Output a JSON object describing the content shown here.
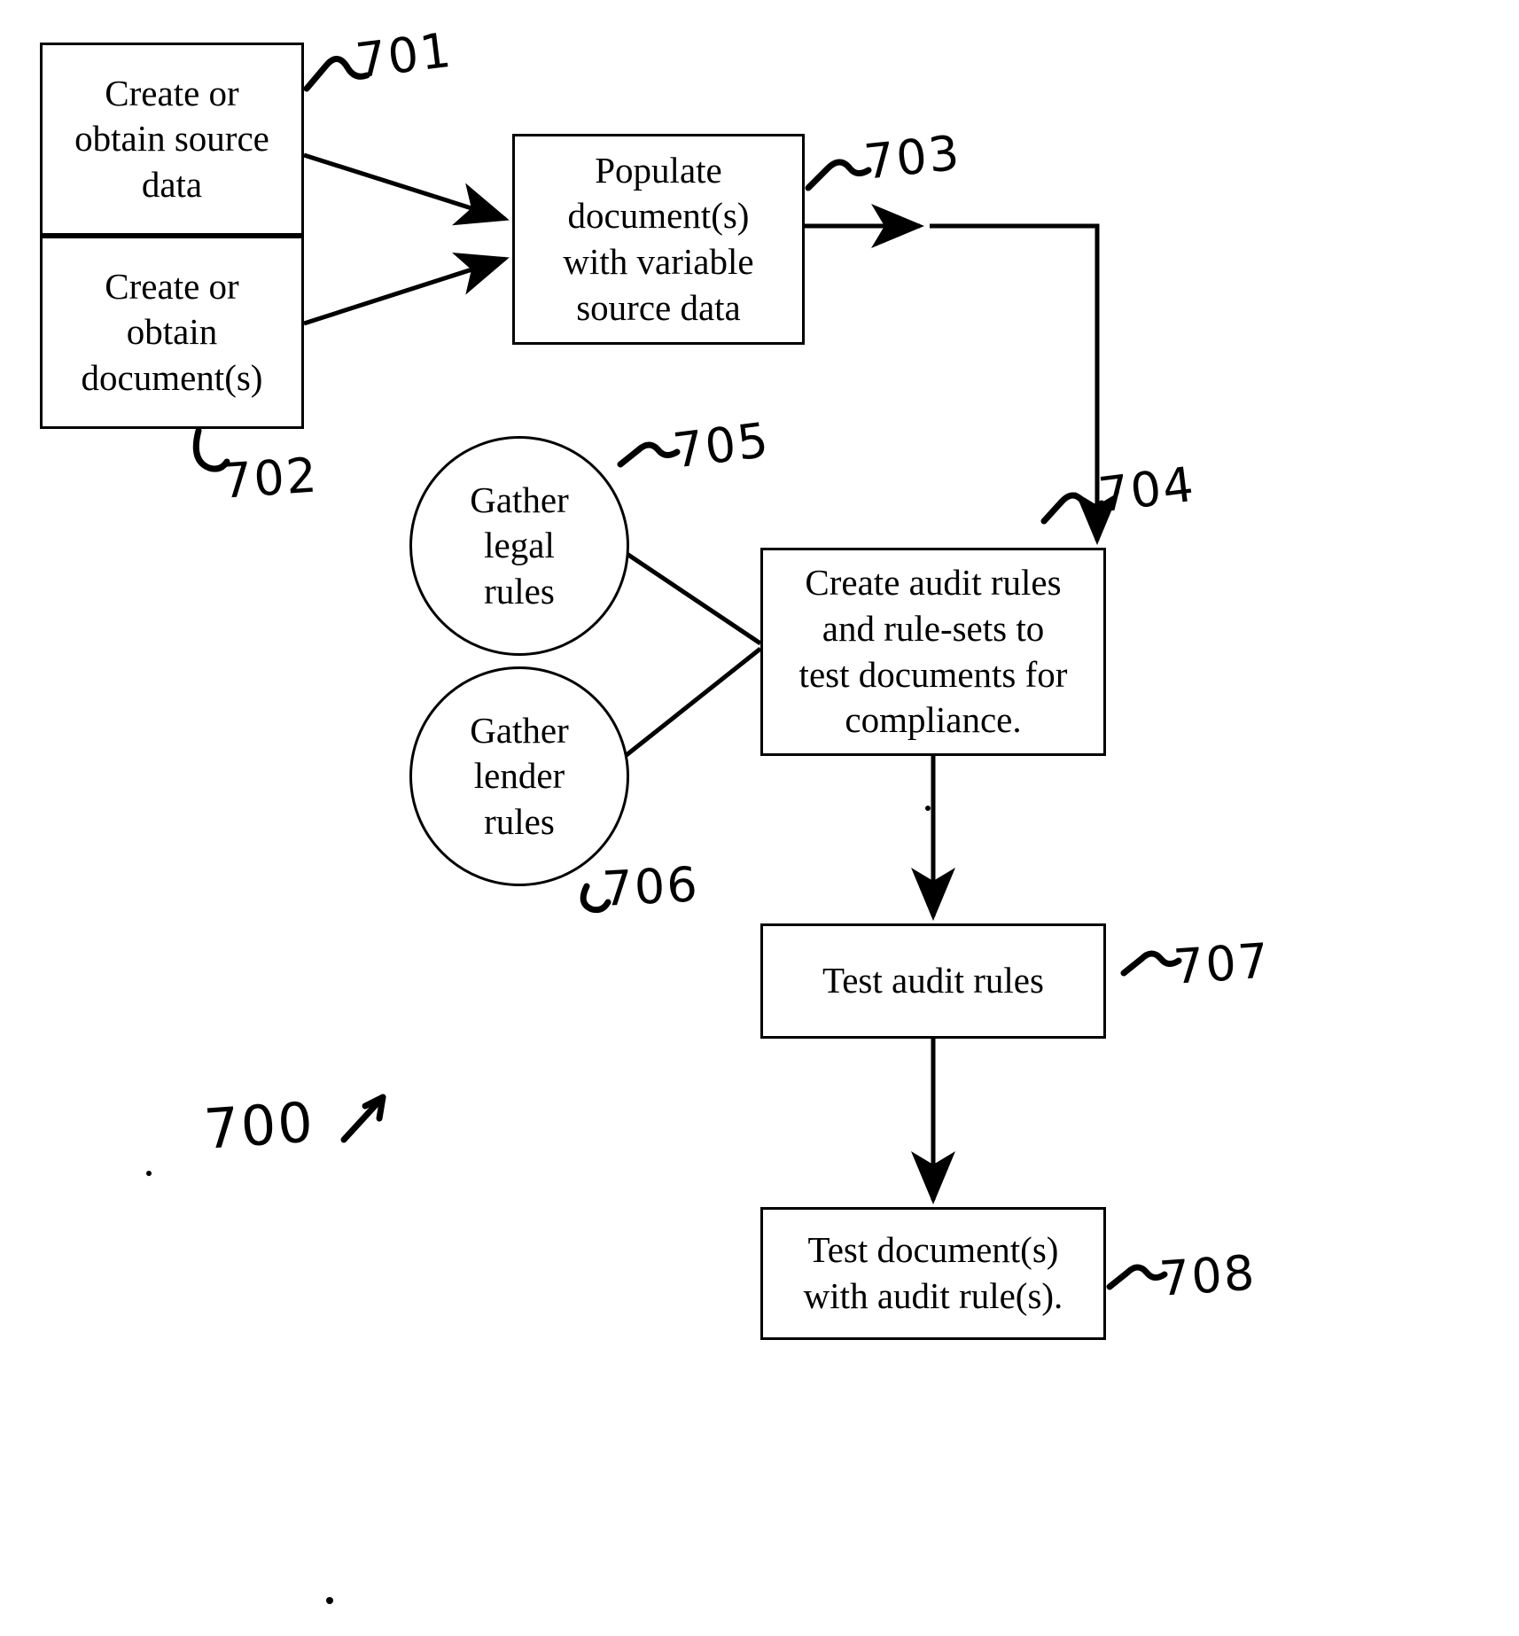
{
  "figure": {
    "type": "patent-flowchart",
    "overall_ref": "700",
    "overall_ref_arrow": "↗"
  },
  "nodes": [
    {
      "id": "701",
      "shape": "rectangle",
      "label": "Create or\nobtain source\ndata",
      "ref": "701",
      "ref_lead": "∼"
    },
    {
      "id": "702",
      "shape": "rectangle",
      "label": "Create or\nobtain\ndocument(s)",
      "ref": "702",
      "ref_lead": "⸂"
    },
    {
      "id": "703",
      "shape": "rectangle",
      "label": "Populate\ndocument(s)\nwith variable\nsource data",
      "ref": "703",
      "ref_lead": "∼"
    },
    {
      "id": "704",
      "shape": "rectangle",
      "label": "Create audit rules\nand rule-sets to\ntest documents for\ncompliance.",
      "ref": "704",
      "ref_lead": "∼"
    },
    {
      "id": "705",
      "shape": "circle",
      "label": "Gather\nlegal\nrules",
      "ref": "705",
      "ref_lead": "∼"
    },
    {
      "id": "706",
      "shape": "circle",
      "label": "Gather\nlender\nrules",
      "ref": "706",
      "ref_lead": "⸂"
    },
    {
      "id": "707",
      "shape": "rectangle",
      "label": "Test audit rules",
      "ref": "707",
      "ref_lead": "∼"
    },
    {
      "id": "708",
      "shape": "rectangle",
      "label": "Test document(s)\nwith audit rule(s).",
      "ref": "708",
      "ref_lead": "∼"
    }
  ],
  "refs": {
    "r700": "700",
    "r701": "701",
    "r702": "702",
    "r703": "703",
    "r704": "704",
    "r705": "705",
    "r706": "706",
    "r707": "707",
    "r708": "708"
  },
  "connectors": [
    {
      "from": "701",
      "to": "703",
      "style": "arrow"
    },
    {
      "from": "702",
      "to": "703",
      "style": "arrow"
    },
    {
      "from": "703",
      "to": "704",
      "style": "elbow-arrow"
    },
    {
      "from": "705",
      "to": "704",
      "style": "line"
    },
    {
      "from": "706",
      "to": "704",
      "style": "line"
    },
    {
      "from": "704",
      "to": "707",
      "style": "arrow"
    },
    {
      "from": "707",
      "to": "708",
      "style": "arrow"
    }
  ],
  "colors": {
    "stroke": "#000000",
    "background": "#ffffff",
    "text": "#000000"
  }
}
